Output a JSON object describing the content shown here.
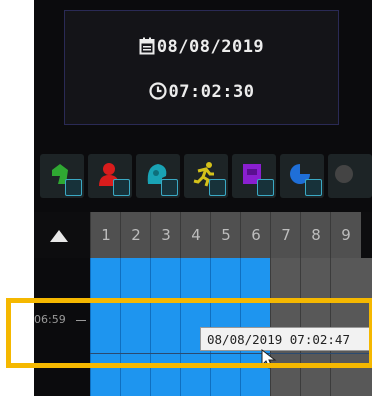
{
  "datetime": {
    "date": "08/08/2019",
    "time": "07:02:30",
    "date_icon": "calendar-icon",
    "time_icon": "clock-icon"
  },
  "event_filters": [
    {
      "name": "motion-event-icon",
      "color": "#2fa832"
    },
    {
      "name": "person-event-icon",
      "color": "#d91c1c"
    },
    {
      "name": "face-event-icon",
      "color": "#19a3b5"
    },
    {
      "name": "running-person-icon",
      "color": "#d4c11a"
    },
    {
      "name": "object-event-icon",
      "color": "#8a1fd0"
    },
    {
      "name": "vehicle-event-icon",
      "color": "#1f6fd8"
    }
  ],
  "channels": [
    "1",
    "2",
    "3",
    "4",
    "5",
    "6",
    "7",
    "8",
    "9"
  ],
  "recording_channels": [
    1,
    2,
    3,
    4,
    5,
    6
  ],
  "timeline": {
    "time_label": "06:59",
    "tooltip": "08/08/2019 07:02:47"
  },
  "colors": {
    "recording": "#1e95ef",
    "no_recording": "#585858",
    "highlight": "#f5b800"
  }
}
